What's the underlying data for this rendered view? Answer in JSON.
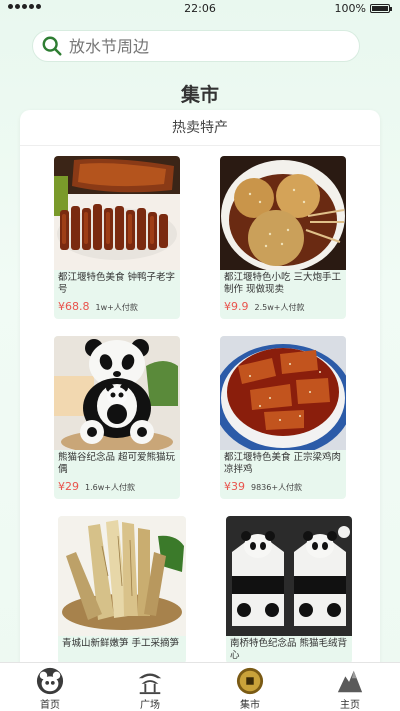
{
  "status": {
    "time": "22:06",
    "battery": "100%"
  },
  "search": {
    "placeholder": "放水节周边"
  },
  "page_title": "集市",
  "section_title": "热卖特产",
  "products": [
    {
      "name": "都江堰特色美食 钟鸭子老字号",
      "price": "¥68.8",
      "sold": "1w+人付款",
      "image_icon": "roast-duck-image"
    },
    {
      "name": "都江堰特色小吃 三大炮手工制作 现做现卖",
      "price": "¥9.9",
      "sold": "2.5w+人付款",
      "image_icon": "sandapao-image"
    },
    {
      "name": "熊猫谷纪念品 超可爱熊猫玩偶",
      "price": "¥29",
      "sold": "1.6w+人付款",
      "image_icon": "panda-plush-image"
    },
    {
      "name": "都江堰特色美食 正宗梁鸡肉凉拌鸡",
      "price": "¥39",
      "sold": "9836+人付款",
      "image_icon": "cold-chicken-image"
    },
    {
      "name": "青城山新鲜嫩笋 手工采摘笋",
      "price": "",
      "sold": "",
      "image_icon": "bamboo-shoot-image"
    },
    {
      "name": "南桥特色纪念品 熊猫毛绒背心",
      "price": "",
      "sold": "",
      "image_icon": "panda-vest-image"
    }
  ],
  "tabs": [
    {
      "label": "首页",
      "icon": "panda-home-icon"
    },
    {
      "label": "广场",
      "icon": "pavilion-icon"
    },
    {
      "label": "集市",
      "icon": "coin-icon"
    },
    {
      "label": "主页",
      "icon": "mountain-icon"
    }
  ],
  "colors": {
    "accent": "#2e7d32",
    "price": "#e9544d",
    "card_bg": "#e8f7ee"
  }
}
